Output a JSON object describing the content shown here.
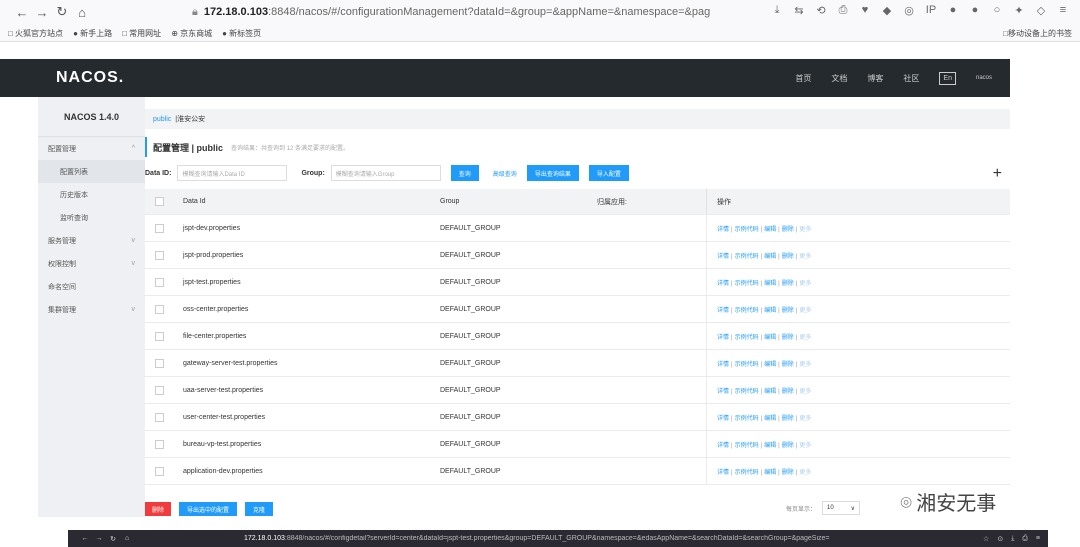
{
  "browser": {
    "nav": [
      "←",
      "→",
      "↻",
      "⌂"
    ],
    "url_host": "172.18.0.103",
    "url_rest": ":8848/nacos/#/configurationManagement?dataId=&group=&appName=&namespace=&pag",
    "ext_icons": [
      "⤓",
      "⇆",
      "⟲",
      "⎙",
      "♥",
      "◆",
      "◎",
      "IP",
      "●",
      "●",
      "○",
      "✦",
      "◇",
      "≡"
    ],
    "bookmarks": [
      "□ 火狐官方站点",
      "● 新手上路",
      "□ 常用网址",
      "⊕ 京东商城",
      "● 新标签页"
    ],
    "mobile_bookmarks": "□移动设备上的书签"
  },
  "topnav": {
    "logo": "NACOS.",
    "links": [
      "首页",
      "文档",
      "博客",
      "社区"
    ],
    "lang": "En",
    "user": "nacos"
  },
  "sidebar": {
    "version": "NACOS 1.4.0",
    "items": [
      {
        "label": "配置管理",
        "chevron": "^",
        "sub": false
      },
      {
        "label": "配置列表",
        "chevron": "",
        "sub": true,
        "active": true
      },
      {
        "label": "历史版本",
        "chevron": "",
        "sub": true
      },
      {
        "label": "监听查询",
        "chevron": "",
        "sub": true
      },
      {
        "label": "服务管理",
        "chevron": "v",
        "sub": false
      },
      {
        "label": "权限控制",
        "chevron": "v",
        "sub": false
      },
      {
        "label": "命名空间",
        "chevron": "",
        "sub": false
      },
      {
        "label": "集群管理",
        "chevron": "v",
        "sub": false
      }
    ]
  },
  "breadcrumb": {
    "ns": "public",
    "sep": " | ",
    "name": "淮安公安"
  },
  "page_head": {
    "title": "配置管理 | public",
    "hint": "查询结果：共查询到 12 条满足要求的配置。"
  },
  "filters": {
    "dataid_label": "Data ID:",
    "dataid_placeholder": "模糊查询请输入Data ID",
    "group_label": "Group:",
    "group_placeholder": "模糊查询请输入Group",
    "query_btn": "查询",
    "advanced_link": "高级查询",
    "export_btn": "导出查询结果",
    "import_btn": "导入配置",
    "plus": "+"
  },
  "table": {
    "headers": [
      "Data Id",
      "Group",
      "归属应用:",
      "操作"
    ],
    "ops": [
      "详情",
      "示例代码",
      "编辑",
      "删除",
      "更多"
    ],
    "rows": [
      {
        "data_id": "jspt-dev.properties",
        "group": "DEFAULT_GROUP",
        "app": ""
      },
      {
        "data_id": "jspt-prod.properties",
        "group": "DEFAULT_GROUP",
        "app": ""
      },
      {
        "data_id": "jspt-test.properties",
        "group": "DEFAULT_GROUP",
        "app": ""
      },
      {
        "data_id": "oss-center.properties",
        "group": "DEFAULT_GROUP",
        "app": ""
      },
      {
        "data_id": "file-center.properties",
        "group": "DEFAULT_GROUP",
        "app": ""
      },
      {
        "data_id": "gateway-server-test.properties",
        "group": "DEFAULT_GROUP",
        "app": ""
      },
      {
        "data_id": "uaa-server-test.properties",
        "group": "DEFAULT_GROUP",
        "app": ""
      },
      {
        "data_id": "user-center-test.properties",
        "group": "DEFAULT_GROUP",
        "app": ""
      },
      {
        "data_id": "bureau-vp-test.properties",
        "group": "DEFAULT_GROUP",
        "app": ""
      },
      {
        "data_id": "application-dev.properties",
        "group": "DEFAULT_GROUP",
        "app": ""
      }
    ]
  },
  "bottom": {
    "delete_btn": "删除",
    "export_selected_btn": "导出选中的配置",
    "clone_btn": "克隆",
    "pagesize_label": "每页显示：",
    "pagesize_value": "10",
    "pagesize_arrow": "∨"
  },
  "watermark": {
    "icon": "◎",
    "text": "湘安无事"
  },
  "bottom_browser": {
    "nav": [
      "←",
      "→",
      "↻",
      "⌂"
    ],
    "url_host": "172.18.0.103",
    "url_rest": ":8848/nacos/#/configdetail?serverId=center&dataId=jspt-test.properties&group=DEFAULT_GROUP&namespace=&edasAppName=&searchDataId=&searchGroup=&pageSize=",
    "icons": [
      "☆",
      "⊙",
      "⤓",
      "⎙",
      "≡"
    ]
  }
}
